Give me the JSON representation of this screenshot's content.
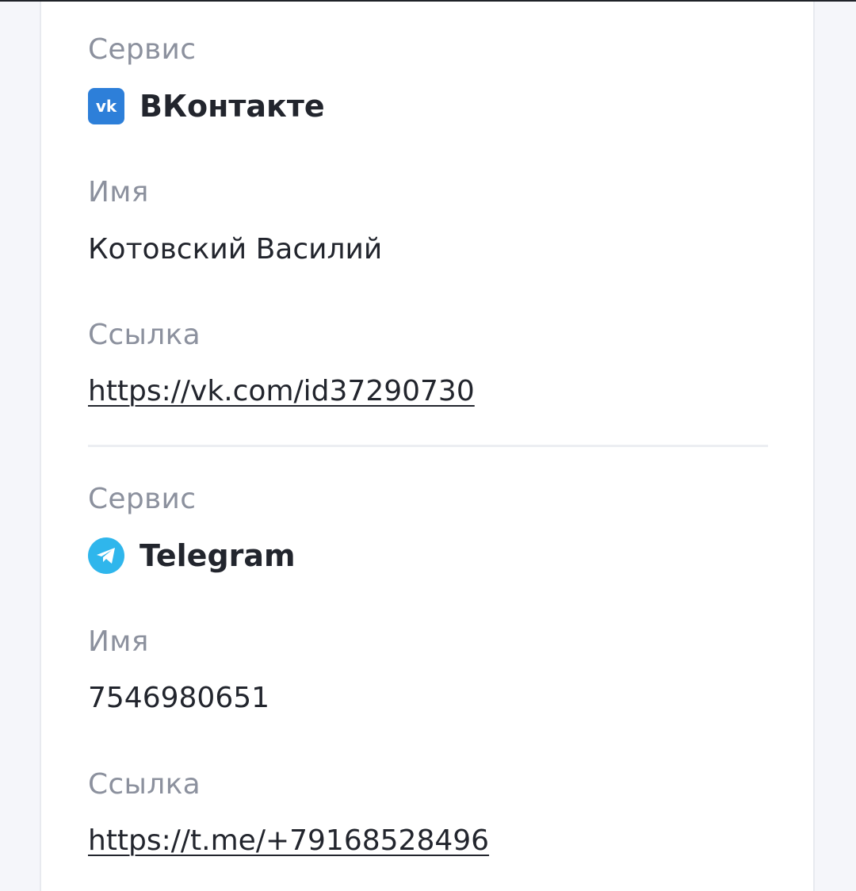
{
  "accounts": [
    {
      "service_label": "Сервис",
      "service_name": "ВКонтакте",
      "service_icon": "vk-icon",
      "name_label": "Имя",
      "name_value": "Котовский Василий",
      "link_label": "Ссылка",
      "link_value": "https://vk.com/id37290730"
    },
    {
      "service_label": "Сервис",
      "service_name": "Telegram",
      "service_icon": "telegram-icon",
      "name_label": "Имя",
      "name_value": "7546980651",
      "link_label": "Ссылка",
      "link_value": "https://t.me/+79168528496"
    }
  ],
  "colors": {
    "vk_brand": "#2d7fd9",
    "telegram_brand": "#2fb6ec",
    "label_text": "#8c919e",
    "value_text": "#22252d"
  }
}
